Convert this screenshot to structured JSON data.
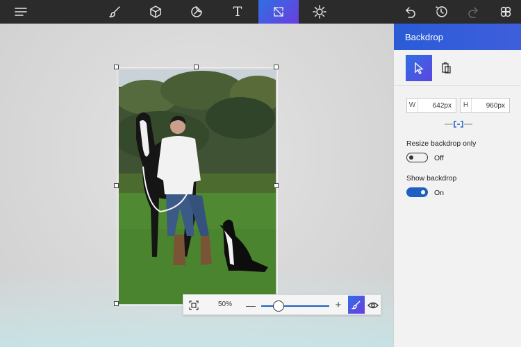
{
  "toolbar": {
    "icons": [
      "menu-icon",
      "brushes-icon",
      "3d-shapes-icon",
      "stickers-icon",
      "text-icon",
      "canvas-icon",
      "effects-icon",
      "undo-icon",
      "history-icon",
      "redo-icon",
      "remix3d-icon"
    ],
    "text_glyph": "T",
    "active_item": "canvas-icon",
    "accent_gradient": [
      "#2f6fe3",
      "#6a3ee0"
    ]
  },
  "panel": {
    "title": "Backdrop",
    "width": {
      "label": "W",
      "value": "642px"
    },
    "height": {
      "label": "H",
      "value": "960px"
    },
    "resize_only": {
      "label": "Resize backdrop only",
      "state": "Off"
    },
    "show_backdrop": {
      "label": "Show backdrop",
      "state": "On"
    }
  },
  "zoom": {
    "percent": "50%",
    "minus": "—",
    "plus": "+",
    "level": 0.25
  },
  "colors": {
    "toolbar_bg": "#2b2b2b",
    "accent_blue": "#1e5fc4",
    "panel_bg": "#f2f2f2"
  }
}
